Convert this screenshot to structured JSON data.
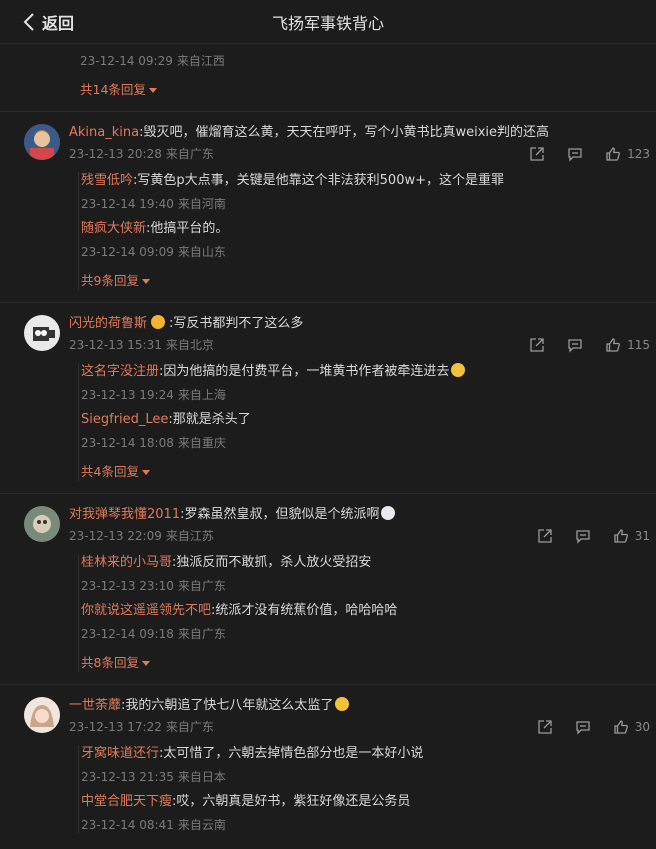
{
  "header": {
    "back_label": "返回",
    "title": "飞扬军事铁背心"
  },
  "top": {
    "meta_time": "23-12-14 09:29",
    "meta_loc": "来自江西",
    "more": "共14条回复"
  },
  "comments": [
    {
      "user": "Akina_kina",
      "text": ":毁灭吧，催熘育这么黄，天天在呼吁，写个小黄书比真weixie判的还高",
      "time": "23-12-13 20:28",
      "loc": "来自广东",
      "likes": "123",
      "replies": [
        {
          "user": "残雪低吟",
          "text": ":写黄色p大点事，关键是他靠这个非法获利500w+，这个是重罪",
          "time": "23-12-14 19:40",
          "loc": "来自河南"
        },
        {
          "user": "随疯大侠新",
          "text": ":他搞平台的。",
          "time": "23-12-14 09:09",
          "loc": "来自山东"
        }
      ],
      "more": "共9条回复"
    },
    {
      "user": "闪光的荷鲁斯",
      "text": ":写反书都判不了这么多",
      "time": "23-12-13 15:31",
      "loc": "来自北京",
      "likes": "115",
      "replies": [
        {
          "user": "这名字没注册",
          "text": ":因为他搞的是付费平台，一堆黄书作者被牵连进去",
          "time": "23-12-13 19:24",
          "loc": "来自上海"
        },
        {
          "user": "Siegfried_Lee",
          "text": ":那就是杀头了",
          "time": "23-12-14 18:08",
          "loc": "来自重庆"
        }
      ],
      "more": "共4条回复"
    },
    {
      "user": "对我弹琴我懂2011",
      "text": ":罗森虽然皇叔，但貌似是个统派啊",
      "time": "23-12-13 22:09",
      "loc": "来自江苏",
      "likes": "31",
      "replies": [
        {
          "user": "桂林来的小马哥",
          "text": ":独派反而不敢抓，杀人放火受招安",
          "time": "23-12-13 23:10",
          "loc": "来自广东"
        },
        {
          "user": "你就说这遥遥领先不吧",
          "text": ":统派才没有统蕉价值，哈哈哈哈",
          "time": "23-12-14 09:18",
          "loc": "来自广东"
        }
      ],
      "more": "共8条回复"
    },
    {
      "user": "一世荼蘼",
      "text": ":我的六朝追了快七八年就这么太监了",
      "time": "23-12-13 17:22",
      "loc": "来自广东",
      "likes": "30",
      "replies": [
        {
          "user": "牙窝味道还行",
          "text": ":太可惜了，六朝去掉情色部分也是一本好小说",
          "time": "23-12-13 21:35",
          "loc": "来自日本"
        },
        {
          "user": "中堂合肥天下瘦",
          "text": ":哎，六朝真是好书，紫狂好像还是公务员",
          "time": "23-12-14 08:41",
          "loc": "来自云南"
        }
      ],
      "more": ""
    }
  ]
}
